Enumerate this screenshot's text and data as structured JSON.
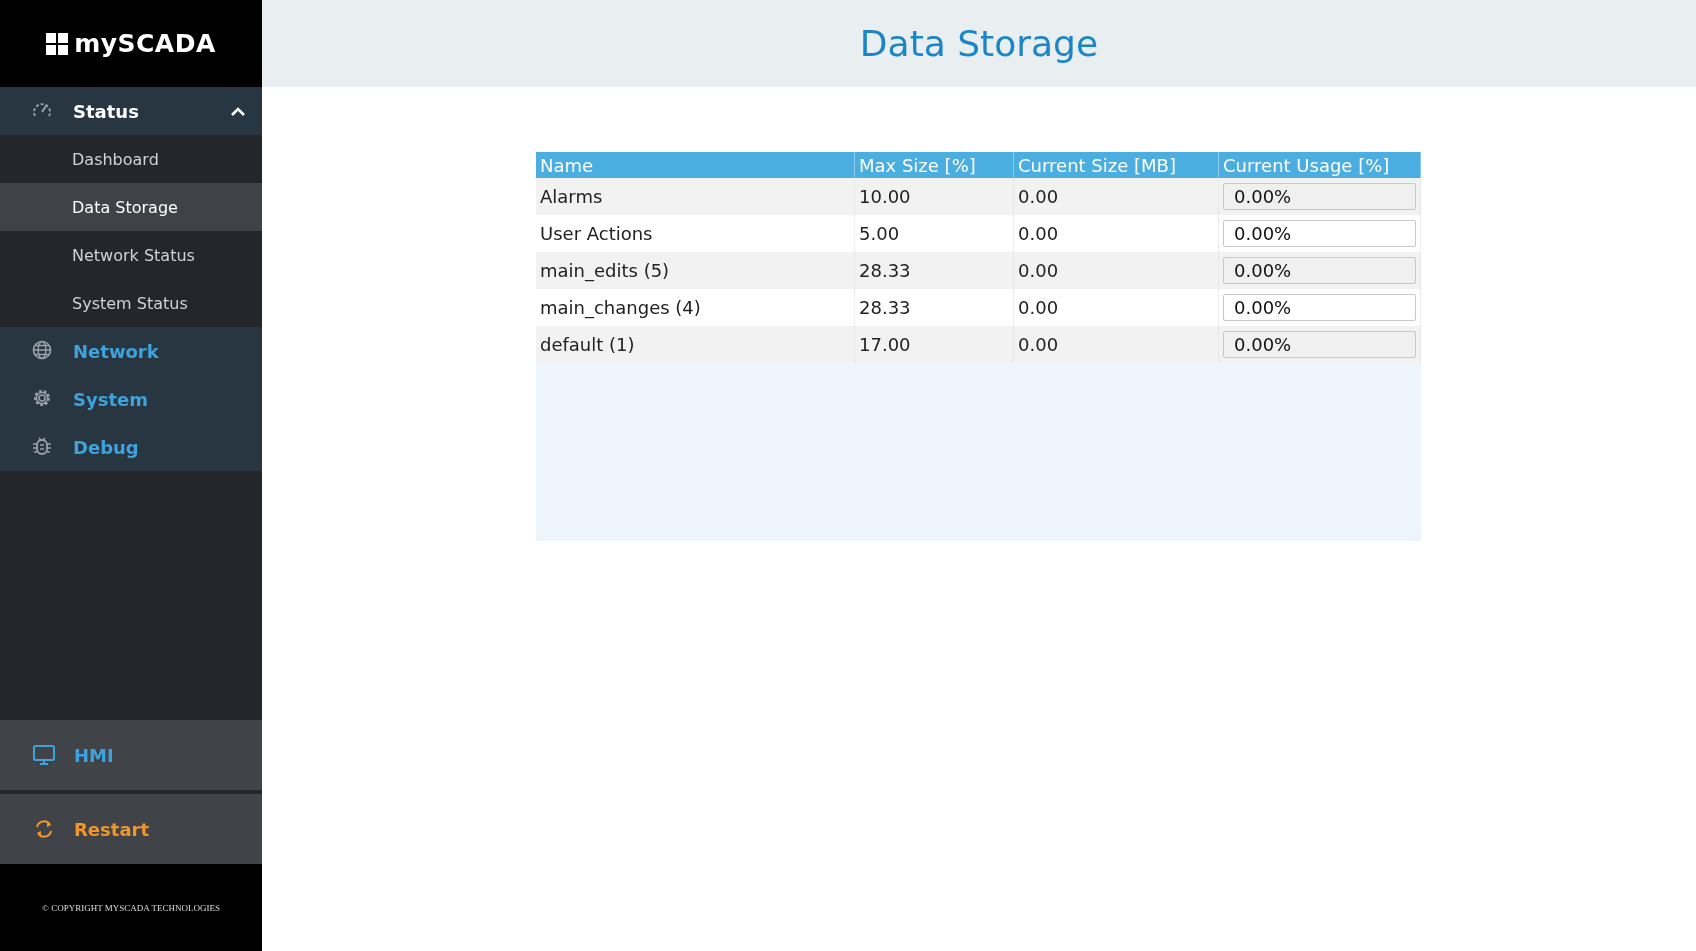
{
  "logo": {
    "text": "mySCADA"
  },
  "sidebar": {
    "items": [
      {
        "label": "Status",
        "expanded": true,
        "children": [
          {
            "label": "Dashboard",
            "selected": false
          },
          {
            "label": "Data Storage",
            "selected": true
          },
          {
            "label": "Network Status",
            "selected": false
          },
          {
            "label": "System Status",
            "selected": false
          }
        ]
      },
      {
        "label": "Network"
      },
      {
        "label": "System"
      },
      {
        "label": "Debug"
      }
    ],
    "bottom": [
      {
        "label": "HMI",
        "kind": "hmi"
      },
      {
        "label": "Restart",
        "kind": "restart"
      }
    ],
    "copyright": "© COPYRIGHT MYSCADA TECHNOLOGIES"
  },
  "page_title": "Data Storage",
  "table": {
    "columns": [
      "Name",
      "Max Size [%]",
      "Current Size [MB]",
      "Current Usage [%]"
    ],
    "rows": [
      {
        "name": "Alarms",
        "max_size": "10.00",
        "current_size": "0.00",
        "usage": "0.00%"
      },
      {
        "name": "User Actions",
        "max_size": "5.00",
        "current_size": "0.00",
        "usage": "0.00%"
      },
      {
        "name": "main_edits (5)",
        "max_size": "28.33",
        "current_size": "0.00",
        "usage": "0.00%"
      },
      {
        "name": "main_changes (4)",
        "max_size": "28.33",
        "current_size": "0.00",
        "usage": "0.00%"
      },
      {
        "name": "default (1)",
        "max_size": "17.00",
        "current_size": "0.00",
        "usage": "0.00%"
      }
    ]
  }
}
